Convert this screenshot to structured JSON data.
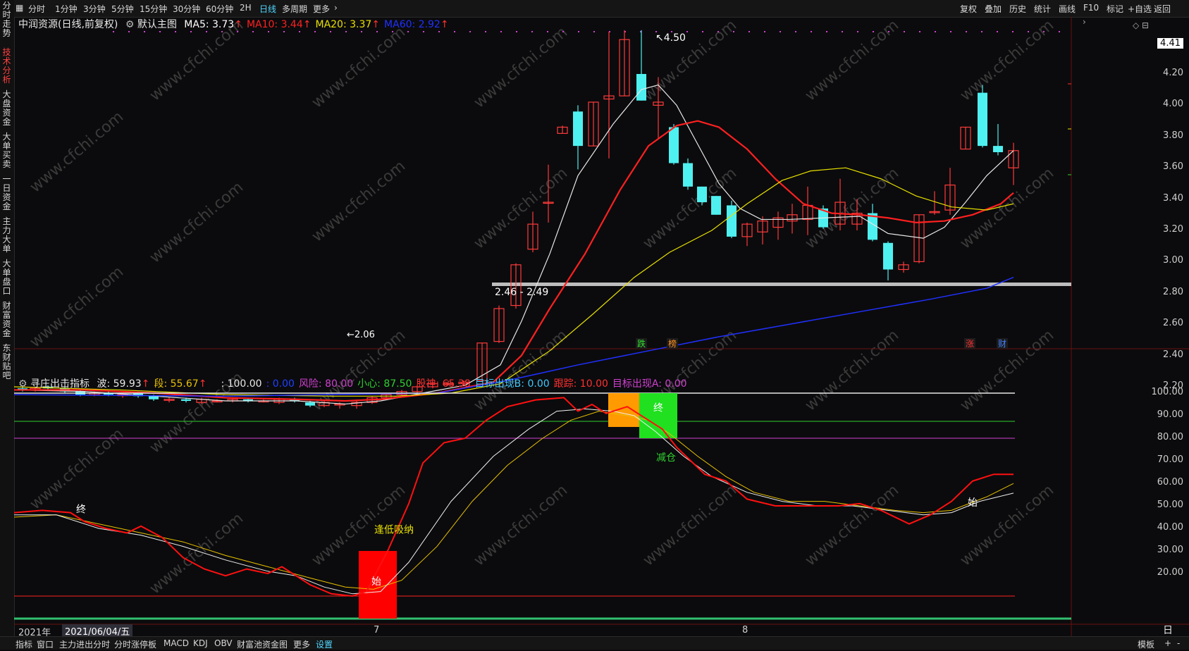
{
  "toolbar": {
    "left": [
      "分时",
      "1分钟",
      "3分钟",
      "5分钟",
      "15分钟",
      "30分钟",
      "60分钟",
      "2H",
      "日线",
      "多周期",
      "更多"
    ],
    "active": "日线",
    "right": [
      "复权",
      "叠加",
      "历史",
      "统计",
      "画线",
      "F10",
      "标记",
      "+自选",
      "返回"
    ]
  },
  "left_tabs": [
    "分时走势",
    "技术分析",
    "大盘资金",
    "大单买卖",
    "一日资金",
    "主力大单",
    "大单盘口",
    "财富资金",
    "东财贴吧"
  ],
  "left_tab_active": "技术分析",
  "main_legend": {
    "title": "中润资源(日线,前复权)",
    "template": "默认主图",
    "ma": [
      {
        "label": "MA5: 3.73",
        "color": "#ffffff"
      },
      {
        "label": "MA10: 3.44",
        "color": "#ff2020"
      },
      {
        "label": "MA20: 3.37",
        "color": "#e8e000"
      },
      {
        "label": "MA60: 2.92",
        "color": "#2030ff"
      }
    ]
  },
  "price_axis": [
    "4.41",
    "4.20",
    "4.00",
    "3.80",
    "3.60",
    "3.40",
    "3.20",
    "3.00",
    "2.80",
    "2.60",
    "2.40",
    "2.20"
  ],
  "price_current": "4.41",
  "annotations": {
    "high": "4.50",
    "low": "2.06",
    "support": "2.46 - 2.49"
  },
  "price_markers": [
    {
      "text": "跌",
      "color": "#30e030"
    },
    {
      "text": "榜",
      "color": "#ff9020"
    },
    {
      "text": "涨",
      "color": "#ff3030"
    },
    {
      "text": "财",
      "color": "#4080ff"
    }
  ],
  "ind_legend": {
    "title": "寻庄出击指标",
    "items": [
      {
        "label": "波: 59.93",
        "color": "#e8e8e8"
      },
      {
        "label": "段: 55.67",
        "color": "#e8c000"
      },
      {
        "label": ": 100.00",
        "color": "#e8e8e8"
      },
      {
        "label": ": 0.00",
        "color": "#2040ff"
      },
      {
        "label": "风险: 80.00",
        "color": "#d040d0"
      },
      {
        "label": "小心: 87.50",
        "color": "#30d030"
      },
      {
        "label": "股神: 65.38",
        "color": "#ff3030"
      },
      {
        "label": "目标出现B: 0.00",
        "color": "#40c8ff"
      },
      {
        "label": "跟踪: 10.00",
        "color": "#ff3030"
      },
      {
        "label": "目标出现A: 0.00",
        "color": "#d040d0"
      }
    ]
  },
  "ind_axis": [
    "100.00",
    "90.00",
    "80.00",
    "70.00",
    "60.00",
    "50.00",
    "40.00",
    "30.00",
    "20.00"
  ],
  "ind_labels": {
    "start1": "始",
    "start2": "始",
    "end1": "终",
    "end2": "终",
    "buy": "逢低吸纳",
    "reduce": "减仓"
  },
  "date_axis": {
    "year": "2021年",
    "cursor_date": "2021/06/04/五",
    "m7": "7",
    "m8": "8",
    "period": "日线"
  },
  "bottom_tabs": [
    "指标",
    "窗口",
    "主力进出分时",
    "分时涨停板",
    "MACD",
    "KDJ",
    "OBV",
    "财富池资金图",
    "更多",
    "设置"
  ],
  "bottom_active": "设置",
  "bottom_right": [
    "模板",
    "+",
    "-"
  ],
  "watermark": "www.cfchi.com",
  "colors": {
    "up": "#ff3a3a",
    "down": "#4ff0f0",
    "bg": "#0b0b0d"
  }
}
